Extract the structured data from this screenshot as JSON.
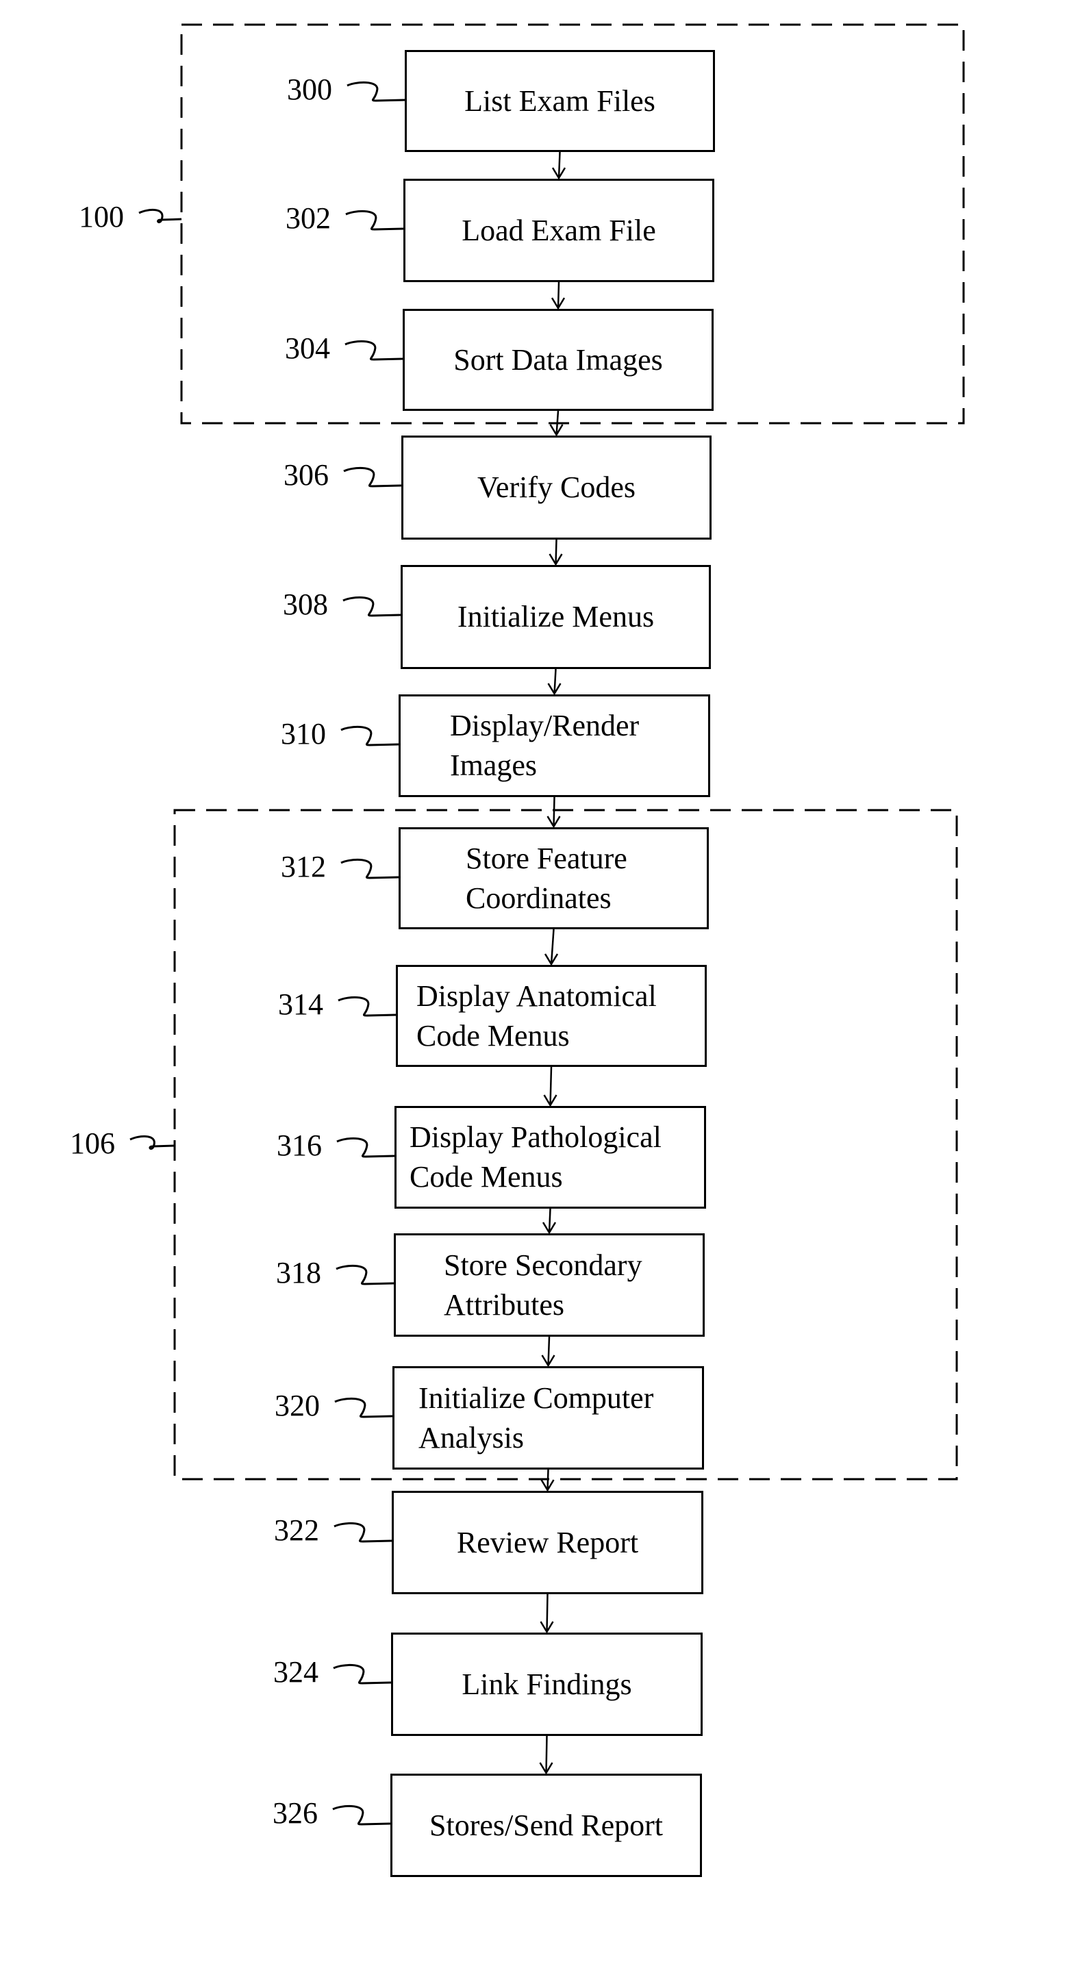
{
  "figure": {
    "groups": [
      {
        "ref": "100",
        "steps": [
          "300",
          "302",
          "304"
        ]
      },
      {
        "ref": "106",
        "steps": [
          "312",
          "314",
          "316",
          "318",
          "320"
        ]
      }
    ],
    "steps": [
      {
        "ref": "300",
        "lines": [
          "List Exam Files"
        ]
      },
      {
        "ref": "302",
        "lines": [
          "Load Exam File"
        ]
      },
      {
        "ref": "304",
        "lines": [
          "Sort Data Images"
        ]
      },
      {
        "ref": "306",
        "lines": [
          "Verify Codes"
        ]
      },
      {
        "ref": "308",
        "lines": [
          "Initialize Menus"
        ]
      },
      {
        "ref": "310",
        "lines": [
          "Display/Render",
          "Images"
        ]
      },
      {
        "ref": "312",
        "lines": [
          "Store Feature",
          "Coordinates"
        ]
      },
      {
        "ref": "314",
        "lines": [
          "Display Anatomical",
          "Code Menus"
        ]
      },
      {
        "ref": "316",
        "lines": [
          "Display Pathological",
          "Code Menus"
        ]
      },
      {
        "ref": "318",
        "lines": [
          "Store Secondary",
          "Attributes"
        ]
      },
      {
        "ref": "320",
        "lines": [
          "Initialize Computer",
          "Analysis"
        ]
      },
      {
        "ref": "322",
        "lines": [
          "Review Report"
        ]
      },
      {
        "ref": "324",
        "lines": [
          "Link Findings"
        ]
      },
      {
        "ref": "326",
        "lines": [
          "Stores/Send Report"
        ]
      }
    ],
    "flow": [
      "300",
      "302",
      "304",
      "306",
      "308",
      "310",
      "312",
      "314",
      "316",
      "318",
      "320",
      "322",
      "324",
      "326"
    ]
  }
}
